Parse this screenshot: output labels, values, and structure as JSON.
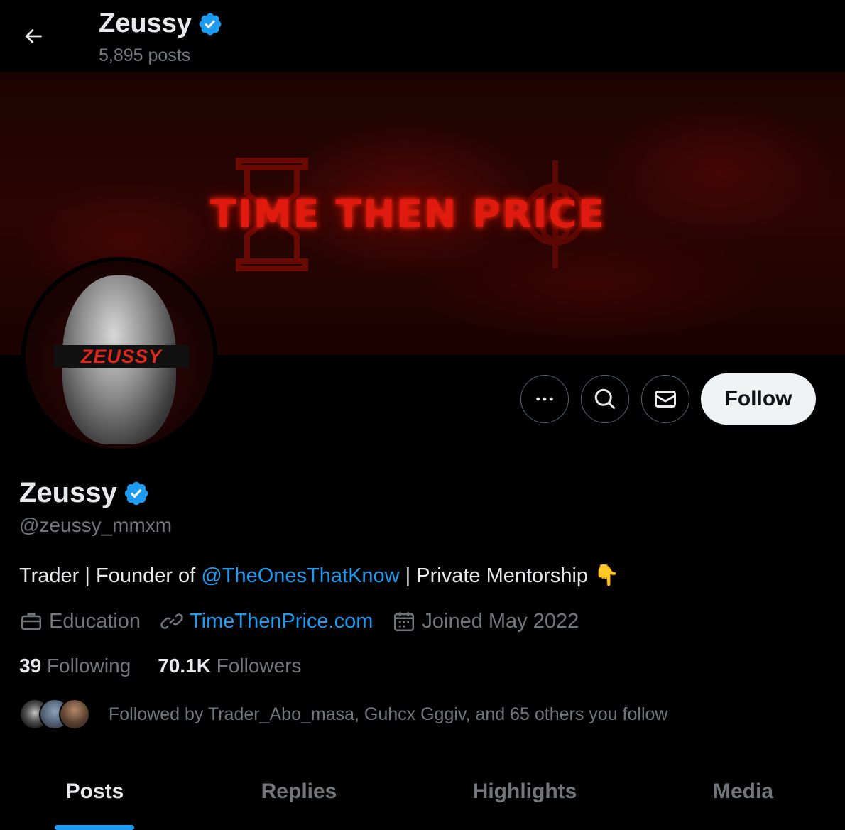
{
  "header": {
    "title": "Zeussy",
    "posts_count": "5,895 posts"
  },
  "banner": {
    "text": "TIME THEN PRICE"
  },
  "avatar": {
    "label": "ZEUSSY"
  },
  "actions": {
    "more_icon": "more-icon",
    "search_icon": "search-icon",
    "message_icon": "mail-icon",
    "follow_label": "Follow"
  },
  "profile": {
    "name": "Zeussy",
    "handle": "@zeussy_mmxm",
    "bio_prefix": "Trader | Founder of ",
    "bio_mention": "@TheOnesThatKnow",
    "bio_suffix": " | Private Mentorship ",
    "bio_emoji": "👇",
    "category": "Education",
    "website": "TimeThenPrice.com",
    "joined": "Joined May 2022",
    "following_count": "39",
    "following_label": "Following",
    "followers_count": "70.1K",
    "followers_label": "Followers",
    "followed_by": "Followed by Trader_Abo_masa, Guhcx Gggiv, and 65 others you follow"
  },
  "tabs": [
    {
      "label": "Posts",
      "active": true
    },
    {
      "label": "Replies",
      "active": false
    },
    {
      "label": "Highlights",
      "active": false
    },
    {
      "label": "Media",
      "active": false
    }
  ],
  "colors": {
    "background": "#000000",
    "accent": "#1d9bf0",
    "muted_text": "#71767b",
    "primary_text": "#e7e9ea",
    "follow_button_bg": "#eff3f4"
  }
}
